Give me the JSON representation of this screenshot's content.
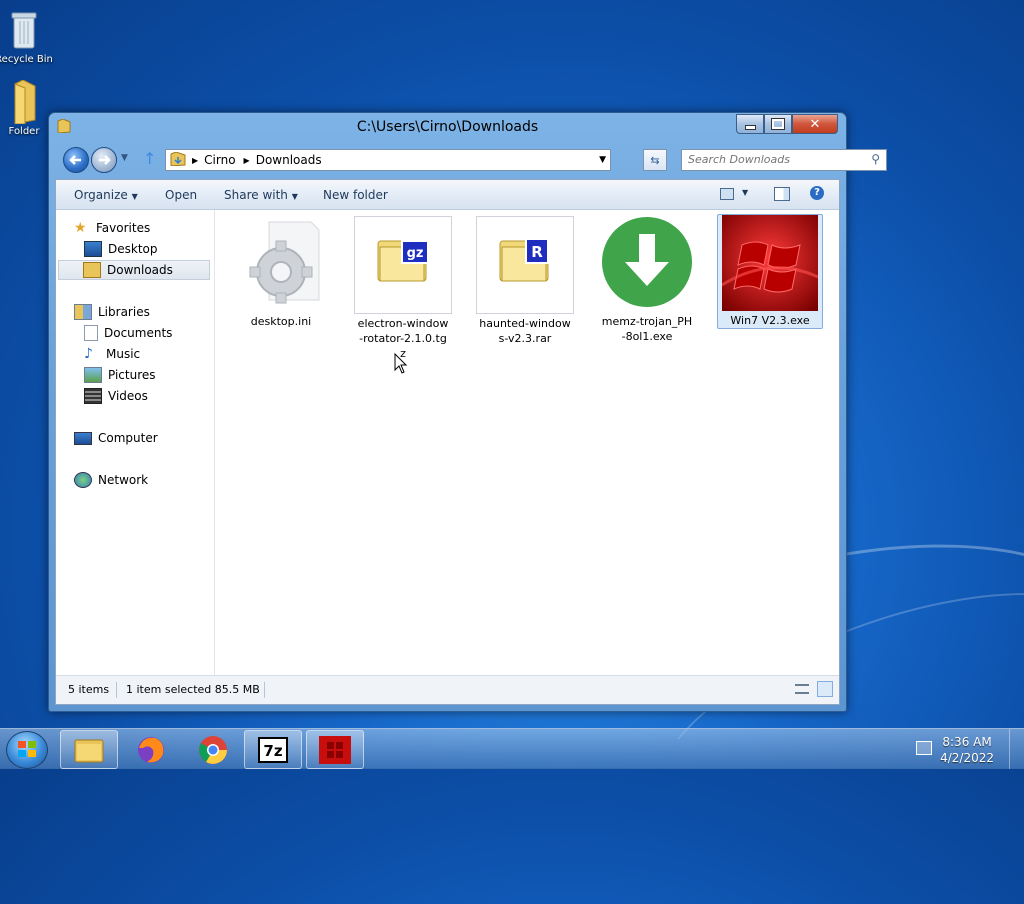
{
  "desktop": {
    "icons": [
      {
        "label": "Recycle Bin",
        "icon": "recycle-bin-icon"
      },
      {
        "label": "Folder",
        "icon": "folder-icon"
      }
    ]
  },
  "window": {
    "title": "C:\\Users\\Cirno\\Downloads",
    "caption_buttons": {
      "minimize": "minimize",
      "maximize": "maximize",
      "close": "close"
    },
    "address": {
      "segments": [
        "Cirno",
        "Downloads"
      ]
    },
    "search": {
      "placeholder": "Search Downloads"
    },
    "toolbar": {
      "organize": "Organize",
      "open": "Open",
      "share_with": "Share with",
      "new_folder": "New folder"
    },
    "nav": {
      "favorites": "Favorites",
      "desktop": "Desktop",
      "downloads": "Downloads",
      "libraries": "Libraries",
      "documents": "Documents",
      "music": "Music",
      "pictures": "Pictures",
      "videos": "Videos",
      "computer": "Computer",
      "network": "Network"
    },
    "files": [
      {
        "name": "desktop.ini",
        "icon": "settings-file-icon"
      },
      {
        "name": "electron-window-rotator-2.1.0.tgz",
        "icon": "gz-archive-icon"
      },
      {
        "name": "haunted-windows-v2.3.rar",
        "icon": "rar-archive-icon"
      },
      {
        "name": "memz-trojan_PH-8ol1.exe",
        "icon": "download-arrow-icon"
      },
      {
        "name": "Win7 V2.3.exe",
        "icon": "red-windows-logo-icon",
        "selected": true
      }
    ],
    "status": {
      "count": "5 items",
      "selection": "1 item selected  85.5 MB"
    }
  },
  "taskbar": {
    "items": [
      "explorer",
      "firefox",
      "chrome",
      "7-zip",
      "win7-v2.3"
    ],
    "clock": {
      "time": "8:36 AM",
      "date": "4/2/2022"
    }
  },
  "colors": {
    "desktop": "#1667c9",
    "window_frame": "#6aa2da",
    "selection": "#dbeaf8",
    "close_button": "#c13d1f",
    "download_green": "#3fa44a",
    "win_red": "#c80d0d"
  }
}
